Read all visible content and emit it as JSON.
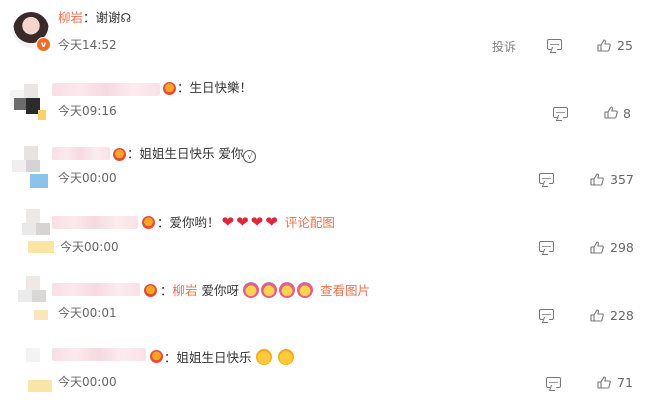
{
  "comments": [
    {
      "name": "柳岩",
      "text": "：谢谢",
      "time": "今天14:52",
      "report": "投诉",
      "likes": "25",
      "verified": true
    },
    {
      "text": "：生日快樂！",
      "time": "今天09:16",
      "likes": "8"
    },
    {
      "text": "：姐姐生日快乐 爱你",
      "time": "今天00:00",
      "likes": "357"
    },
    {
      "text": "：爱你哟！",
      "link": "评论配图",
      "time": "今天00:00",
      "likes": "298"
    },
    {
      "mention": "柳岩",
      "text": " 爱你呀",
      "link": "查看图片",
      "time": "今天00:01",
      "likes": "228"
    },
    {
      "text": "：姐姐生日快乐",
      "time": "今天00:00",
      "likes": "71"
    }
  ],
  "colors": {
    "accent": "#eb7350",
    "heart": "#e0263a",
    "meta": "#808080"
  },
  "icons": [
    "reply-icon",
    "like-icon",
    "vip-medal-icon",
    "verified-badge-icon"
  ]
}
